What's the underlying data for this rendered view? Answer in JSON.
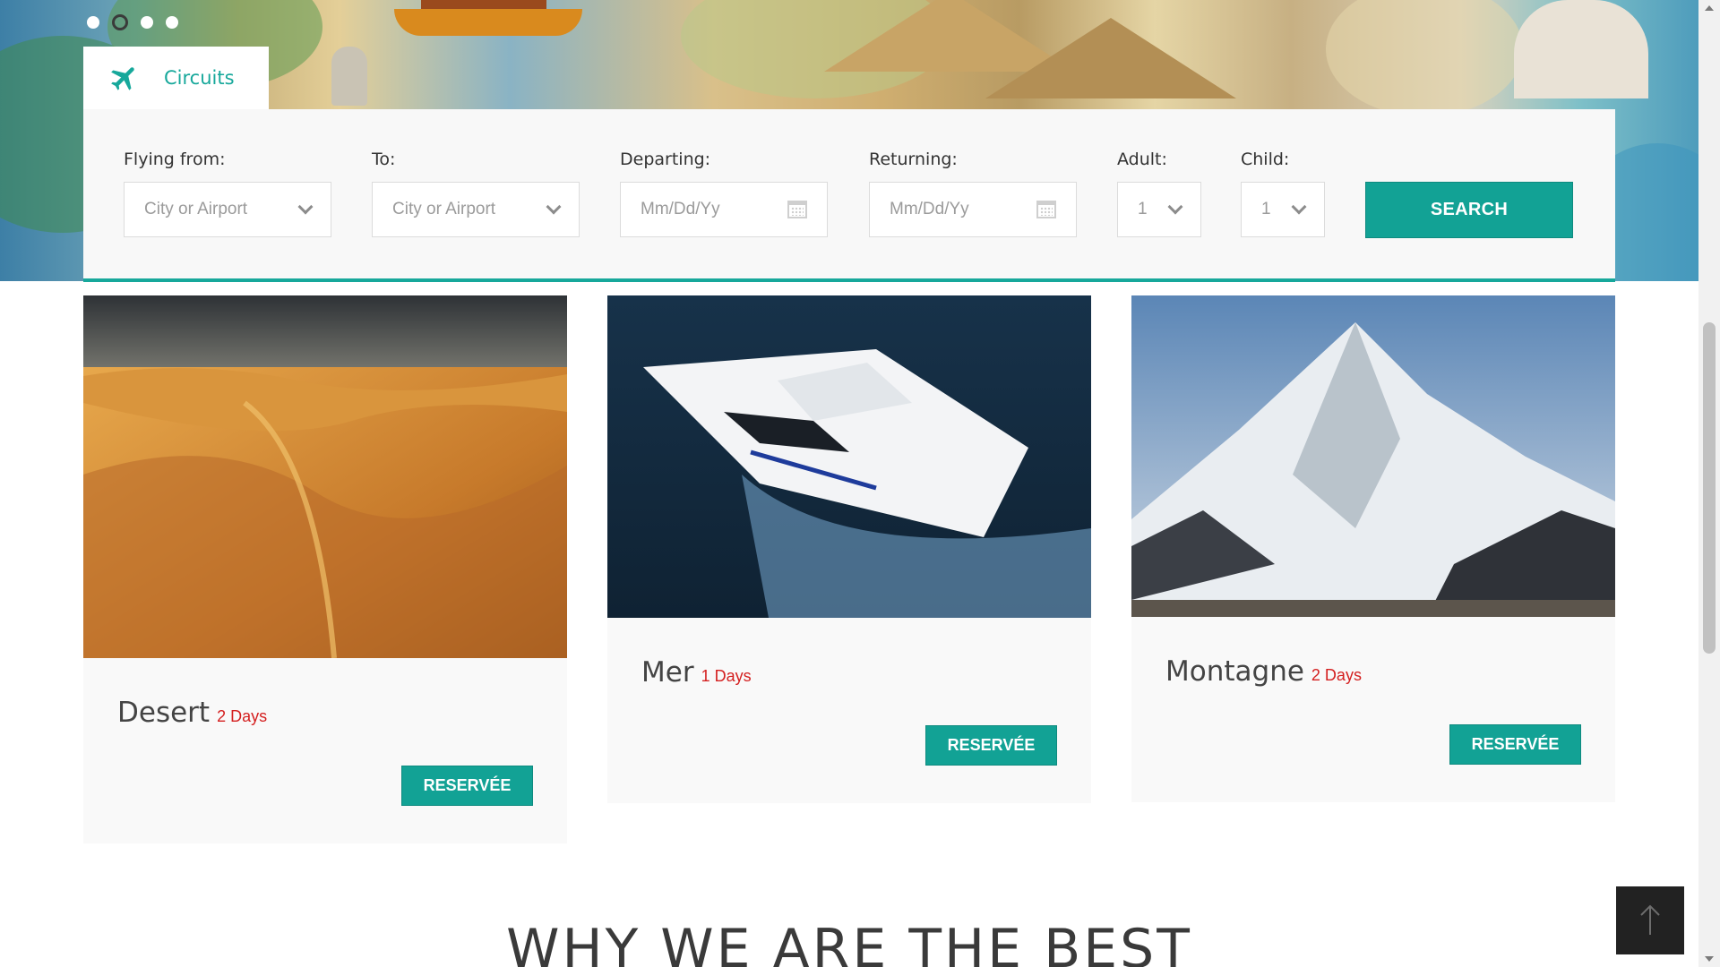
{
  "hero": {
    "tab_label": "Circuits",
    "tab_icon": "plane-icon",
    "slide_count": 4,
    "active_slide": 2
  },
  "search": {
    "from_label": "Flying from:",
    "from_placeholder": "City or Airport",
    "to_label": "To:",
    "to_placeholder": "City or Airport",
    "departing_label": "Departing:",
    "departing_placeholder": "Mm/Dd/Yy",
    "returning_label": "Returning:",
    "returning_placeholder": "Mm/Dd/Yy",
    "adult_label": "Adult:",
    "adult_value": "1",
    "child_label": "Child:",
    "child_value": "1",
    "button_label": "SEARCH"
  },
  "cards": [
    {
      "title": "Desert",
      "days": "2 Days",
      "button": "RESERVÉE"
    },
    {
      "title": "Mer",
      "days": "1 Days",
      "button": "RESERVÉE"
    },
    {
      "title": "Montagne",
      "days": "2 Days",
      "button": "RESERVÉE"
    }
  ],
  "section": {
    "heading": "WHY WE ARE THE BEST"
  },
  "colors": {
    "accent": "#12a295",
    "days": "#d41f1f"
  }
}
